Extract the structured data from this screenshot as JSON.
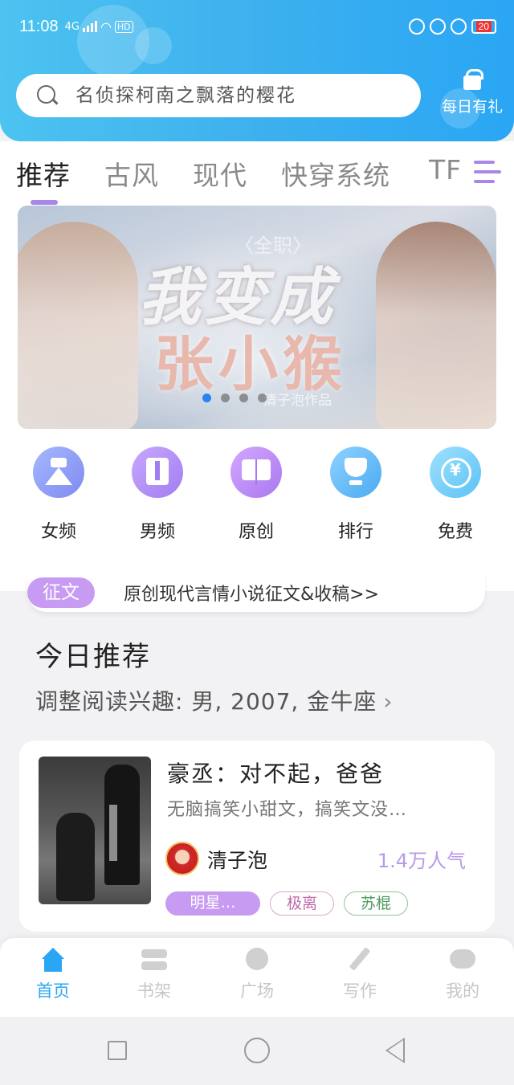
{
  "status_bar": {
    "time": "11:08",
    "network": "4G",
    "hd": "HD",
    "battery": "20",
    "accent_battery_color": "#e33333"
  },
  "search": {
    "placeholder": "名侦探柯南之飘落的樱花"
  },
  "daily_gift": {
    "label": "每日有礼",
    "icon": "gift-icon"
  },
  "tabs": [
    {
      "label": "推荐",
      "active": true
    },
    {
      "label": "古风"
    },
    {
      "label": "现代"
    },
    {
      "label": "快穿系统"
    },
    {
      "label": "TF"
    }
  ],
  "banner": {
    "subtitle": "〈全职〉",
    "title_line1": "我变成",
    "title_line2": "张小猴",
    "author": "清子泡作品",
    "dots": 4,
    "active_dot": 0
  },
  "categories": [
    {
      "label": "女频",
      "icon": "dress-icon"
    },
    {
      "label": "男频",
      "icon": "shirt-icon"
    },
    {
      "label": "原创",
      "icon": "book-icon"
    },
    {
      "label": "排行",
      "icon": "trophy-icon"
    },
    {
      "label": "免费",
      "icon": "coin-icon"
    }
  ],
  "notice": {
    "tag": "征文",
    "text": "原创现代言情小说征文&收稿>>"
  },
  "recommend": {
    "title": "今日推荐",
    "subtitle": "调整阅读兴趣: 男, 2007, 金牛座",
    "chevron": "›"
  },
  "book": {
    "title": "豪丞：对不起，爸爸",
    "description": "无脑搞笑小甜文，搞笑文没…",
    "author": "清子泡",
    "popularity": "1.4万人气",
    "tags": [
      "明星…",
      "极离",
      "苏棍"
    ]
  },
  "bottom_nav": [
    {
      "label": "首页",
      "icon": "home-icon",
      "active": true
    },
    {
      "label": "书架",
      "icon": "bookshelf-icon"
    },
    {
      "label": "广场",
      "icon": "plaza-icon"
    },
    {
      "label": "写作",
      "icon": "pen-icon"
    },
    {
      "label": "我的",
      "icon": "chat-icon"
    }
  ],
  "colors": {
    "header_blue": "#3fb2ee",
    "accent_purple": "#a987e8",
    "active_nav_blue": "#2aa6f4"
  }
}
